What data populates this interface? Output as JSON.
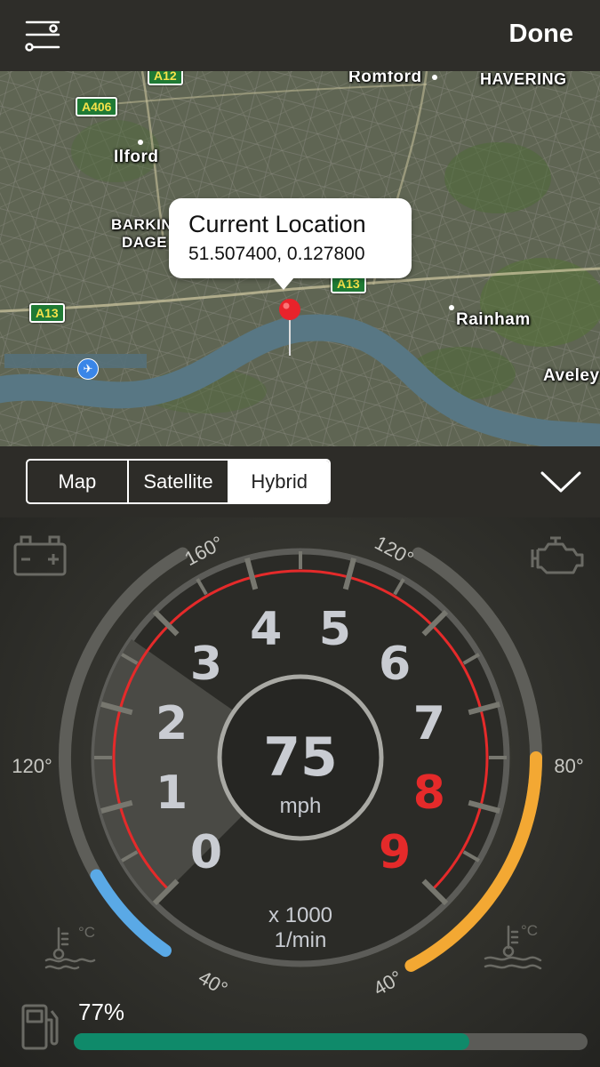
{
  "header": {
    "done_label": "Done"
  },
  "map": {
    "places": [
      "Romford",
      "HAVERING",
      "Ilford",
      "BARKING",
      "DAGE",
      "Rainham",
      "Aveley"
    ],
    "roads": [
      "A12",
      "A406",
      "A13",
      "A13"
    ],
    "callout": {
      "title": "Current Location",
      "coords": "51.507400, 0.127800"
    }
  },
  "map_modes": {
    "options": [
      "Map",
      "Satellite",
      "Hybrid"
    ],
    "selected": "Hybrid"
  },
  "gauge": {
    "speed": "75",
    "speed_unit": "mph",
    "rpm_multiplier": "x 1000",
    "rpm_unit": "1/min",
    "rpm_digits": [
      "0",
      "1",
      "2",
      "3",
      "4",
      "5",
      "6",
      "7",
      "8",
      "9"
    ],
    "rpm_redline_from": 8,
    "rpm_highlighted_upto": 2,
    "left_arc": {
      "top_label": "160°",
      "mid_label": "120°",
      "bottom_label": "40°",
      "color": "#5aa9e6"
    },
    "right_arc": {
      "top_label": "120°",
      "mid_label": "80°",
      "bottom_label": "40°",
      "color": "#f3a833"
    },
    "redline_color": "#e52a2a"
  },
  "fuel": {
    "percent_label": "77%",
    "level": 0.77,
    "color": "#0f8a6a"
  },
  "icons": [
    "menu-icon",
    "chevron-down-icon",
    "battery-icon",
    "engine-icon",
    "oil-temp-icon",
    "coolant-temp-icon",
    "fuel-pump-icon",
    "airport-icon",
    "location-pin-icon"
  ]
}
